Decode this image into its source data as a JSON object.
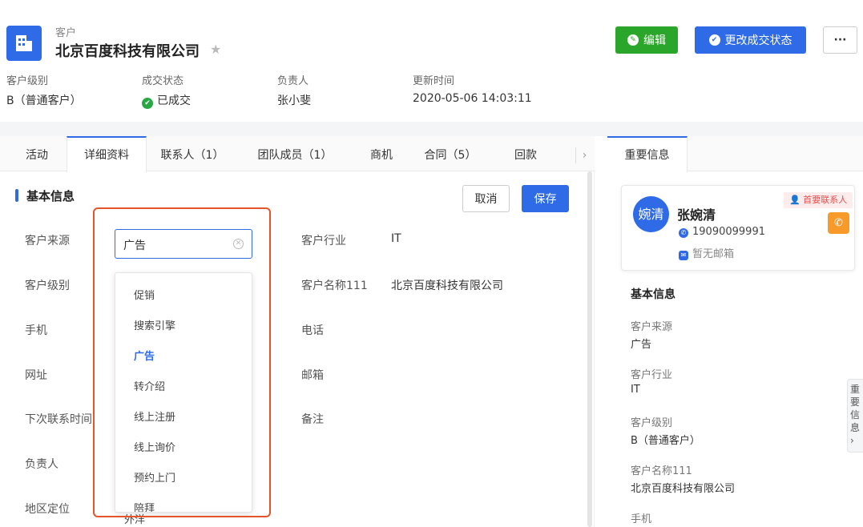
{
  "header": {
    "entity_type": "客户",
    "title": "北京百度科技有限公司",
    "edit_label": "编辑",
    "change_status_label": "更改成交状态",
    "more_label": "···"
  },
  "meta": [
    {
      "label": "客户级别",
      "value": "B（普通客户）"
    },
    {
      "label": "成交状态",
      "value": "已成交"
    },
    {
      "label": "负责人",
      "value": "张小斐"
    },
    {
      "label": "更新时间",
      "value": "2020-05-06 14:03:11"
    }
  ],
  "tabs": [
    "活动",
    "详细资料",
    "联系人（1）",
    "团队成员（1）",
    "商机",
    "合同（5）",
    "回款"
  ],
  "active_tab": "详细资料",
  "form": {
    "section_title": "基本信息",
    "cancel_label": "取消",
    "save_label": "保存",
    "left_labels": [
      "客户来源",
      "客户级别",
      "手机",
      "网址",
      "下次联系时间",
      "负责人",
      "地区定位"
    ],
    "right_fields": [
      {
        "label": "客户行业",
        "value": "IT"
      },
      {
        "label": "客户名称111",
        "value": "北京百度科技有限公司"
      },
      {
        "label": "电话",
        "value": ""
      },
      {
        "label": "邮箱",
        "value": ""
      },
      {
        "label": "备注",
        "value": ""
      }
    ],
    "source_select": {
      "value": "广告",
      "options": [
        "促销",
        "搜索引擎",
        "广告",
        "转介绍",
        "线上注册",
        "线上询价",
        "预约上门",
        "陪拜"
      ],
      "selected_index": 2
    },
    "partial_text": "外洋"
  },
  "right_panel": {
    "tab_label": "重要信息",
    "contact": {
      "avatar_text": "婉清",
      "name": "张婉清",
      "badge": "首要联系人",
      "phone": "19090099991",
      "email": "暂无邮箱"
    },
    "section_title": "基本信息",
    "fields": [
      {
        "label": "客户来源",
        "value": "广告"
      },
      {
        "label": "客户行业",
        "value": "IT"
      },
      {
        "label": "客户级别",
        "value": "B（普通客户）"
      },
      {
        "label": "客户名称111",
        "value": "北京百度科技有限公司"
      },
      {
        "label": "手机",
        "value": ""
      }
    ],
    "side_tab": "重要信息"
  },
  "colors": {
    "primary": "#2f6be6",
    "success": "#2aa72a",
    "highlight": "#e4562a",
    "call": "#f79a2a"
  }
}
